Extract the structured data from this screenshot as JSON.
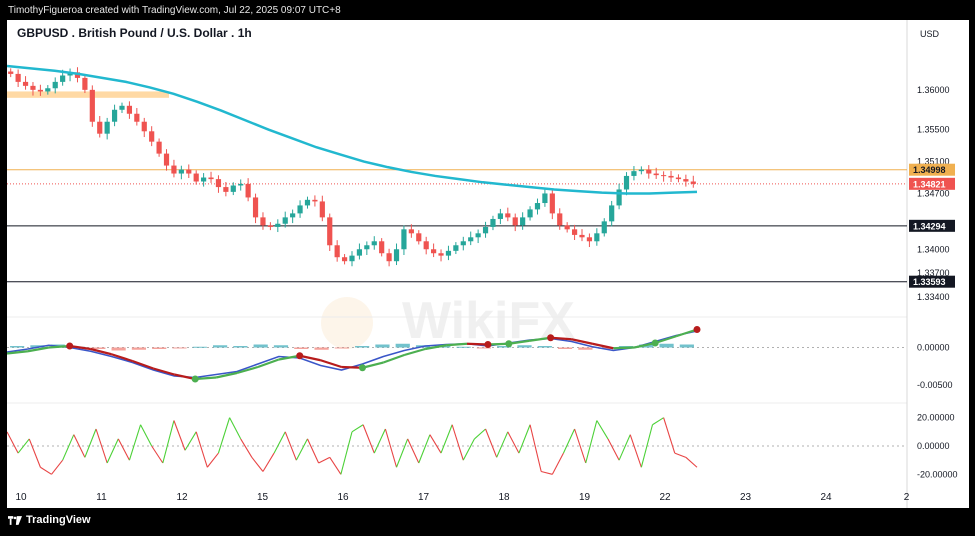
{
  "header": {
    "attribution": "TimothyFigueroa created with TradingView.com, Jul 22, 2025 09:07 UTC+8",
    "symbol_title": "GBPUSD . British Pound / U.S. Dollar . 1h",
    "currency": "USD"
  },
  "footer": {
    "brand": "TradingView"
  },
  "watermark": "WikiFX",
  "colors": {
    "up": "#26a69a",
    "down": "#ef5350",
    "ma": "#22b8cf",
    "resistance": "#f0b050",
    "zone": "#ffd59a",
    "macd_fast": "#3a56c8",
    "macd_slow_up": "#4caf50",
    "macd_slow_down": "#b71c1c",
    "osc_up": "#4cd137",
    "osc_down": "#e84545"
  },
  "chart_data": [
    {
      "type": "candlestick",
      "title": "GBPUSD . British Pound / U.S. Dollar . 1h",
      "y_ticks": [
        "1.36000",
        "1.35500",
        "1.35100",
        "1.34700",
        "1.34000",
        "1.33700",
        "1.33400"
      ],
      "y_range": [
        1.3315,
        1.365
      ],
      "x_ticks": [
        "10",
        "11",
        "12",
        "15",
        "16",
        "17",
        "18",
        "19",
        "22",
        "23",
        "24",
        "2"
      ],
      "closes": [
        1.362,
        1.361,
        1.3605,
        1.36,
        1.3598,
        1.3602,
        1.361,
        1.3618,
        1.3622,
        1.3615,
        1.36,
        1.356,
        1.3545,
        1.356,
        1.3575,
        1.358,
        1.357,
        1.356,
        1.3548,
        1.3535,
        1.352,
        1.3505,
        1.3495,
        1.35,
        1.3495,
        1.3485,
        1.349,
        1.3488,
        1.3478,
        1.3472,
        1.348,
        1.3482,
        1.3465,
        1.344,
        1.343,
        1.3428,
        1.3432,
        1.344,
        1.3445,
        1.3455,
        1.3462,
        1.346,
        1.344,
        1.3405,
        1.339,
        1.3385,
        1.3392,
        1.34,
        1.3405,
        1.341,
        1.3395,
        1.3385,
        1.34,
        1.3425,
        1.342,
        1.341,
        1.34,
        1.3395,
        1.3392,
        1.3398,
        1.3405,
        1.341,
        1.3415,
        1.342,
        1.3428,
        1.3438,
        1.3445,
        1.344,
        1.343,
        1.344,
        1.345,
        1.3458,
        1.347,
        1.3445,
        1.343,
        1.3425,
        1.3418,
        1.3415,
        1.341,
        1.342,
        1.3435,
        1.3455,
        1.3475,
        1.3492,
        1.3498,
        1.35,
        1.3495,
        1.3493,
        1.3492,
        1.349,
        1.3488,
        1.3485,
        1.3482
      ],
      "series": [
        {
          "name": "",
          "type": "line",
          "values": [
            1.363,
            1.3627,
            1.3624,
            1.362,
            1.3615,
            1.361,
            1.3603,
            1.3595,
            1.3585,
            1.3574,
            1.3562,
            1.355,
            1.3539,
            1.3528,
            1.3519,
            1.351,
            1.3503,
            1.3497,
            1.3492,
            1.3488,
            1.3484,
            1.3481,
            1.3478,
            1.3475,
            1.3473,
            1.3471,
            1.347,
            1.347,
            1.3471,
            1.3472
          ]
        }
      ],
      "horizontal_levels": [
        {
          "price": 1.34998,
          "label": "1.34998",
          "style": "resistance"
        },
        {
          "price": 1.34821,
          "label": "1.34821",
          "style": "last-price"
        },
        {
          "price": 1.34294,
          "label": "1.34294",
          "style": "support"
        },
        {
          "price": 1.33593,
          "label": "1.33593",
          "style": "support"
        }
      ],
      "zone": {
        "from": 1.359,
        "to": 1.3598
      }
    },
    {
      "type": "line",
      "y_ticks": [
        "0.00000",
        "-0.00500"
      ],
      "y_range": [
        -0.007,
        0.003
      ],
      "series": [
        {
          "name": "",
          "values": [
            -0.0006,
            -0.0002,
            0.0003,
            0.0,
            -0.0005,
            -0.0012,
            -0.002,
            -0.003,
            -0.0038,
            -0.004,
            -0.0036,
            -0.0032,
            -0.0022,
            -0.0012,
            -0.0014,
            -0.0024,
            -0.003,
            -0.0022,
            -0.0012,
            -0.0004,
            0.0002,
            0.0004,
            0.0005,
            0.0002,
            0.0006,
            0.001,
            0.0012,
            0.0008,
            0.0001,
            -0.0004,
            0.0,
            0.0008,
            0.0016,
            0.0022
          ]
        },
        {
          "name": "",
          "values": [
            -0.0008,
            -0.0005,
            0.0,
            0.0002,
            -0.0002,
            -0.0009,
            -0.0018,
            -0.0028,
            -0.0036,
            -0.0042,
            -0.004,
            -0.0034,
            -0.0026,
            -0.0016,
            -0.0011,
            -0.0017,
            -0.0026,
            -0.0027,
            -0.002,
            -0.001,
            -0.0002,
            0.0003,
            0.0005,
            0.0004,
            0.0005,
            0.0009,
            0.0013,
            0.0011,
            0.0005,
            -0.0001,
            0.0,
            0.0006,
            0.0015,
            0.0024
          ]
        }
      ],
      "histogram": [
        0.0002,
        0.0003,
        0.0004,
        0.0001,
        -0.0002,
        -0.0004,
        -0.0003,
        -0.0002,
        -0.0001,
        0.0001,
        0.0003,
        0.0002,
        0.0004,
        0.0003,
        -0.0002,
        -0.0003,
        -0.0001,
        0.0002,
        0.0004,
        0.0005,
        0.0003,
        0.0002,
        0.0001,
        -0.0001,
        0.0002,
        0.0003,
        0.0002,
        -0.0002,
        -0.0003,
        -0.0002,
        0.0002,
        0.0004,
        0.0005,
        0.0004
      ]
    },
    {
      "type": "line",
      "y_ticks": [
        "20.00000",
        "0.00000",
        "-20.00000"
      ],
      "y_range": [
        -24,
        24
      ],
      "series": [
        {
          "name": "",
          "values": [
            10,
            -5,
            5,
            -15,
            -20,
            -10,
            8,
            -8,
            12,
            -12,
            5,
            -10,
            15,
            0,
            -12,
            18,
            -3,
            10,
            -15,
            -5,
            20,
            5,
            -8,
            -18,
            -5,
            10,
            -10,
            5,
            -12,
            -8,
            -20,
            10,
            15,
            -5,
            12,
            -15,
            5,
            -12,
            8,
            -5,
            15,
            -10,
            5,
            12,
            -8,
            10,
            -5,
            15,
            -18,
            -20,
            -5,
            12,
            -12,
            18,
            5,
            -10,
            8,
            -15,
            15,
            20,
            -5,
            -8,
            -15
          ]
        }
      ]
    }
  ]
}
